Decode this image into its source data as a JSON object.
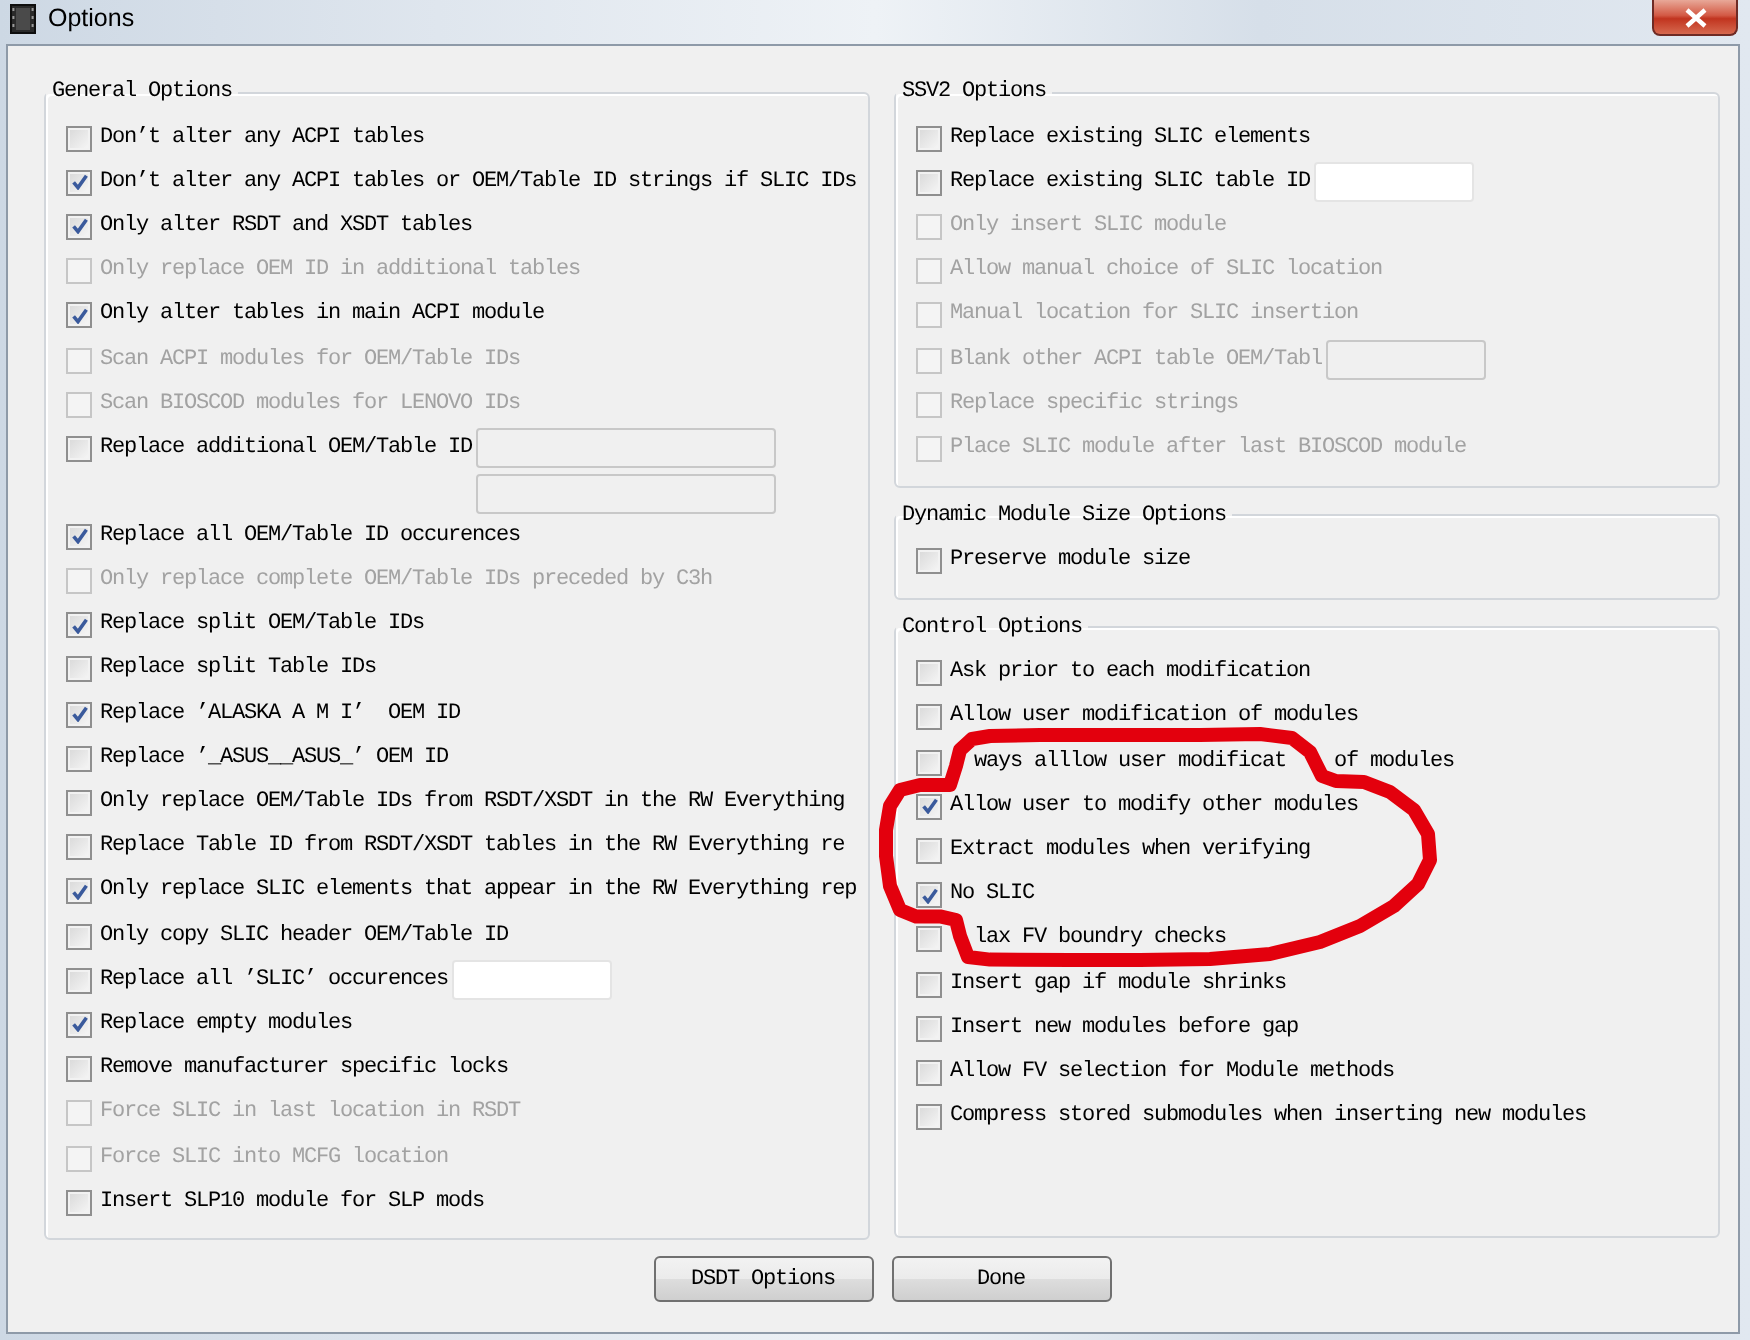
{
  "window": {
    "title": "Options"
  },
  "columns": [
    {
      "groups": [
        {
          "title": "General Options",
          "items": [
            {
              "label": "Don’t alter any ACPI tables",
              "checked": false,
              "disabled": false
            },
            {
              "label": "Don’t alter any ACPI tables or OEM/Table ID strings if SLIC IDs",
              "checked": true,
              "disabled": false
            },
            {
              "label": "Only alter RSDT and XSDT tables",
              "checked": true,
              "disabled": false
            },
            {
              "label": "Only replace OEM ID in additional tables",
              "checked": false,
              "disabled": true
            },
            {
              "label": "Only alter tables in main ACPI module",
              "checked": true,
              "disabled": false
            },
            {
              "label": "Scan ACPI modules for OEM/Table IDs",
              "checked": false,
              "disabled": true
            },
            {
              "label": "Scan BIOSCOD modules for LENOVO IDs",
              "checked": false,
              "disabled": true
            },
            {
              "label": "Replace additional OEM/Table ID",
              "checked": false,
              "disabled": false,
              "fields": [
                {
                  "disabled": true
                },
                {
                  "disabled": true
                }
              ]
            },
            {
              "label": "Replace all OEM/Table ID occurences",
              "checked": true,
              "disabled": false
            },
            {
              "label": "Only replace complete OEM/Table IDs preceded by C3h",
              "checked": false,
              "disabled": true
            },
            {
              "label": "Replace split OEM/Table IDs",
              "checked": true,
              "disabled": false
            },
            {
              "label": "Replace split Table IDs",
              "checked": false,
              "disabled": false
            },
            {
              "label": "Replace ’ALASKA A M I’  OEM ID",
              "checked": true,
              "disabled": false
            },
            {
              "label": "Replace ’_ASUS__ASUS_’ OEM ID",
              "checked": false,
              "disabled": false
            },
            {
              "label": "Only replace OEM/Table IDs from RSDT/XSDT in the RW Everything",
              "checked": false,
              "disabled": false
            },
            {
              "label": "Replace Table ID from RSDT/XSDT tables in the RW Everything re",
              "checked": false,
              "disabled": false
            },
            {
              "label": "Only replace SLIC elements that appear in the RW Everything rep",
              "checked": true,
              "disabled": false
            },
            {
              "label": "Only copy SLIC header OEM/Table ID",
              "checked": false,
              "disabled": false
            },
            {
              "label": "Replace all ’SLIC’ occurences",
              "checked": false,
              "disabled": false,
              "fields": [
                {
                  "disabled": false
                }
              ]
            },
            {
              "label": "Replace empty modules",
              "checked": true,
              "disabled": false
            },
            {
              "label": "Remove manufacturer specific locks",
              "checked": false,
              "disabled": false
            },
            {
              "label": "Force SLIC in last location in RSDT",
              "checked": false,
              "disabled": true
            },
            {
              "label": "Force SLIC into MCFG location",
              "checked": false,
              "disabled": true
            },
            {
              "label": "Insert SLP10 module for SLP mods",
              "checked": false,
              "disabled": false
            }
          ]
        }
      ]
    },
    {
      "groups": [
        {
          "title": "SSV2 Options",
          "items": [
            {
              "label": "Replace existing SLIC elements",
              "checked": false,
              "disabled": false
            },
            {
              "label": "Replace existing SLIC table ID",
              "checked": false,
              "disabled": false,
              "fields": [
                {
                  "disabled": false
                }
              ]
            },
            {
              "label": "Only insert SLIC module",
              "checked": false,
              "disabled": true
            },
            {
              "label": "Allow manual choice of SLIC location",
              "checked": false,
              "disabled": true
            },
            {
              "label": "Manual location for SLIC insertion",
              "checked": false,
              "disabled": true
            },
            {
              "label": "Blank other ACPI table OEM/Tabl",
              "checked": false,
              "disabled": true,
              "fields": [
                {
                  "disabled": true
                }
              ]
            },
            {
              "label": "Replace specific strings",
              "checked": false,
              "disabled": true
            },
            {
              "label": "Place SLIC module after last BIOSCOD module",
              "checked": false,
              "disabled": true
            }
          ]
        },
        {
          "title": "Dynamic Module Size Options",
          "items": [
            {
              "label": "Preserve module size",
              "checked": false,
              "disabled": false
            }
          ]
        },
        {
          "title": "Control Options",
          "items": [
            {
              "label": "Ask prior to each modification",
              "checked": false,
              "disabled": false
            },
            {
              "label": "Allow user modification of modules",
              "checked": false,
              "disabled": false
            },
            {
              "label_parts": [
                "ways alllow user modificat",
                "of modules"
              ],
              "checked": false,
              "disabled": false
            },
            {
              "label": "Allow user to modify other modules",
              "checked": true,
              "disabled": false
            },
            {
              "label": "Extract modules when verifying",
              "checked": false,
              "disabled": false
            },
            {
              "label": "No SLIC",
              "checked": true,
              "disabled": false
            },
            {
              "label_parts": [
                "lax FV boundry checks"
              ],
              "checked": false,
              "disabled": false
            },
            {
              "label": "Insert gap if module shrinks",
              "checked": false,
              "disabled": false
            },
            {
              "label": "Insert new modules before gap",
              "checked": false,
              "disabled": false
            },
            {
              "label": "Allow FV selection for Module methods",
              "checked": false,
              "disabled": false
            },
            {
              "label": "Compress stored submodules when inserting new modules",
              "checked": false,
              "disabled": false
            }
          ]
        }
      ]
    }
  ],
  "buttons": [
    "DSDT Options",
    "Done"
  ]
}
